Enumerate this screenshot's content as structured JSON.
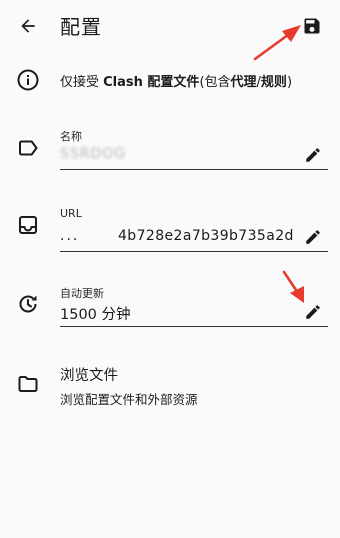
{
  "header": {
    "title": "配置",
    "back_icon": "arrow-back-icon",
    "save_icon": "save-floppy-icon"
  },
  "info": {
    "icon": "info-icon",
    "parts": [
      "仅接受 ",
      "Clash 配置文件",
      "(包含",
      "代理",
      "/",
      "规则",
      ")"
    ]
  },
  "name_field": {
    "label": "名称",
    "value": "SSRDOG",
    "icon": "label-tag-icon"
  },
  "url_field": {
    "label": "URL",
    "prefix": "...",
    "value": "4b728e2a7b39b735a2d",
    "icon": "inbox-tray-icon"
  },
  "update_field": {
    "label": "自动更新",
    "value": "1500 分钟",
    "icon": "update-clock-icon"
  },
  "browse": {
    "title": "浏览文件",
    "subtitle": "浏览配置文件和外部资源",
    "icon": "folder-icon"
  },
  "colors": {
    "background": "#fafafa",
    "text": "#1b1b1b",
    "arrow_annotation": "#e8392f"
  }
}
